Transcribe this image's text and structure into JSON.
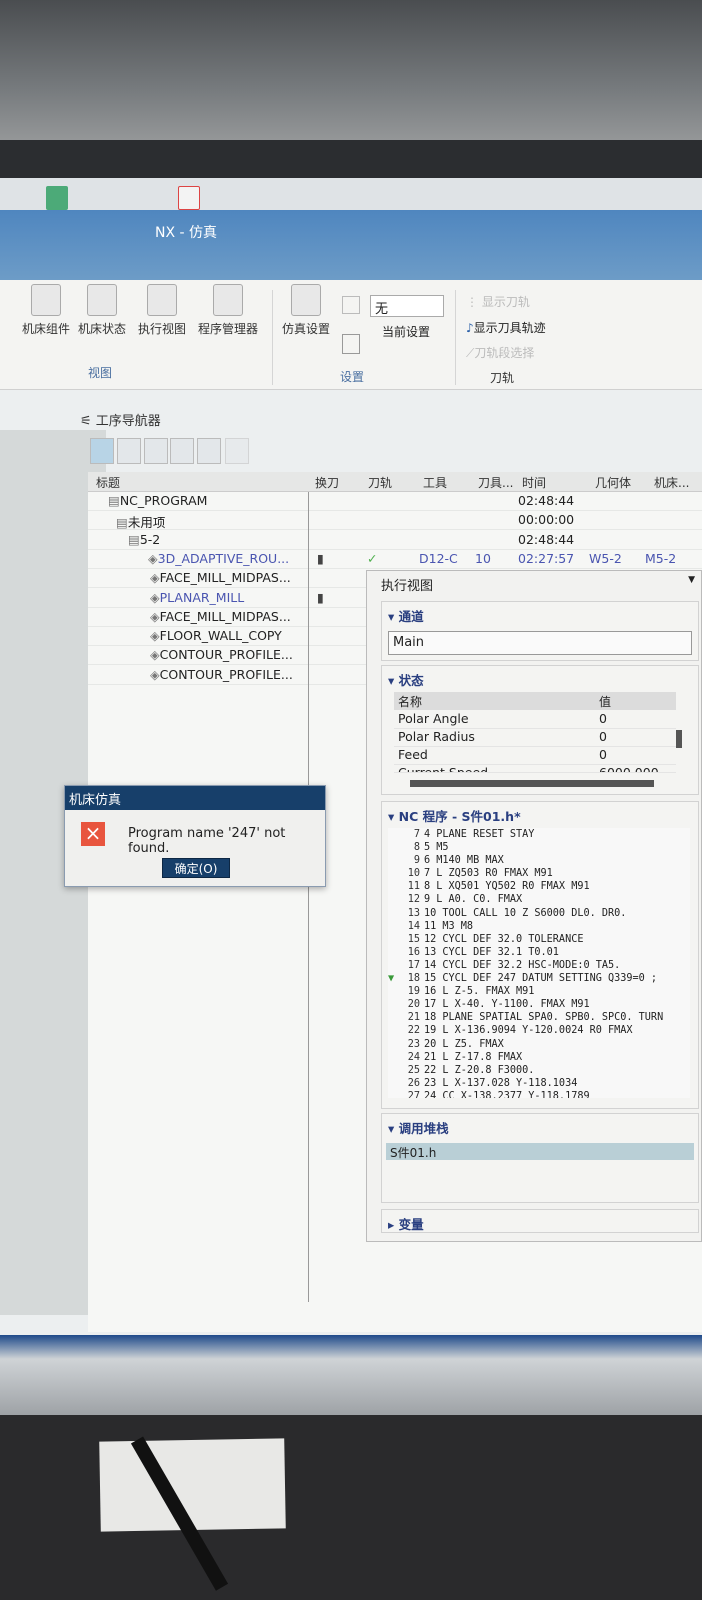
{
  "window": {
    "title": "NX - 仿真"
  },
  "ribbon": {
    "buttons": [
      "机床组件",
      "机床状态",
      "执行视图",
      "程序管理器"
    ],
    "group_view": "视图",
    "sim_settings": "仿真设置",
    "current_setting_value": "无",
    "current_setting_label": "当前设置",
    "group_settings": "设置",
    "show_toolpath": "显示刀轨",
    "show_tool_trace": "显示刀具轨迹",
    "toolpath_segment_select": "刀轨段选择",
    "group_toolpath": "刀轨"
  },
  "navigator": {
    "title": "工序导航器",
    "columns": [
      "标题",
      "换刀",
      "刀轨",
      "工具",
      "刀具...",
      "时间",
      "几何体",
      "机床..."
    ],
    "rows": [
      {
        "name": "NC_PROGRAM",
        "time": "02:48:44"
      },
      {
        "name": "未用项",
        "time": "00:00:00"
      },
      {
        "name": "5-2",
        "time": "02:48:44"
      },
      {
        "name": "3D_ADAPTIVE_ROU...",
        "toolchange": true,
        "path": "✓",
        "tool": "D12-C",
        "toolnum": "10",
        "time": "02:27:57",
        "geometry": "W5-2",
        "machine": "M5-2"
      },
      {
        "name": "FACE_MILL_MIDPAS...",
        "path": "✓"
      },
      {
        "name": "PLANAR_MILL",
        "toolchange": true,
        "path": "✓"
      },
      {
        "name": "FACE_MILL_MIDPAS...",
        "path": "✓"
      },
      {
        "name": "FLOOR_WALL_COPY",
        "path": "✓"
      },
      {
        "name": "CONTOUR_PROFILE...",
        "path": "✓"
      },
      {
        "name": "CONTOUR_PROFILE...",
        "path": "✓"
      }
    ]
  },
  "dialog": {
    "title": "机床仿真",
    "message": "Program name '247' not found.",
    "ok": "确定(O)"
  },
  "exec_view": {
    "title": "执行视图",
    "channel": {
      "label": "通道",
      "value": "Main"
    },
    "status": {
      "label": "状态",
      "col_name": "名称",
      "col_value": "值",
      "rows": [
        {
          "name": "Polar Angle",
          "value": "0"
        },
        {
          "name": "Polar Radius",
          "value": "0"
        },
        {
          "name": "Feed",
          "value": "0"
        },
        {
          "name": "Current Speed",
          "value": "6000.000 -"
        }
      ]
    },
    "nc_program": {
      "label": "NC 程序 - S件01.h*",
      "lines": [
        [
          "7",
          "4 PLANE RESET STAY"
        ],
        [
          "8",
          "5 M5"
        ],
        [
          "9",
          "6 M140 MB MAX"
        ],
        [
          "10",
          "7 L ZQ503 R0 FMAX M91"
        ],
        [
          "11",
          "8 L XQ501 YQ502 R0 FMAX M91"
        ],
        [
          "12",
          "9 L A0. C0. FMAX"
        ],
        [
          "13",
          "10 TOOL CALL 10 Z S6000 DL0. DR0."
        ],
        [
          "14",
          "11 M3 M8"
        ],
        [
          "15",
          "12 CYCL DEF 32.0 TOLERANCE"
        ],
        [
          "16",
          "13 CYCL DEF 32.1 T0.01"
        ],
        [
          "17",
          "14 CYCL DEF 32.2 HSC-MODE:0 TA5."
        ],
        [
          "18",
          "15 CYCL DEF 247 DATUM SETTING Q339=0 ;"
        ],
        [
          "19",
          "16 L Z-5. FMAX M91"
        ],
        [
          "20",
          "17 L X-40. Y-1100. FMAX M91"
        ],
        [
          "21",
          "18 PLANE SPATIAL SPA0. SPB0. SPC0. TURN"
        ],
        [
          "22",
          "19 L X-136.9094 Y-120.0024 R0 FMAX"
        ],
        [
          "23",
          "20 L Z5. FMAX"
        ],
        [
          "24",
          "21 L Z-17.8 FMAX"
        ],
        [
          "25",
          "22 L Z-20.8 F3000."
        ],
        [
          "26",
          "23 L X-137.028 Y-118.1034"
        ],
        [
          "27",
          "24 CC X-138.2377 Y-118.1789"
        ]
      ],
      "current_line": "18"
    },
    "call_stack": {
      "label": "调用堆栈",
      "items": [
        "S件01.h"
      ]
    },
    "variables": {
      "label": "变量"
    }
  },
  "colors": {
    "titlebar": "#5b8fc0",
    "dialog_title": "#173f6a",
    "error": "#e8553e",
    "check": "#4fb04f"
  }
}
